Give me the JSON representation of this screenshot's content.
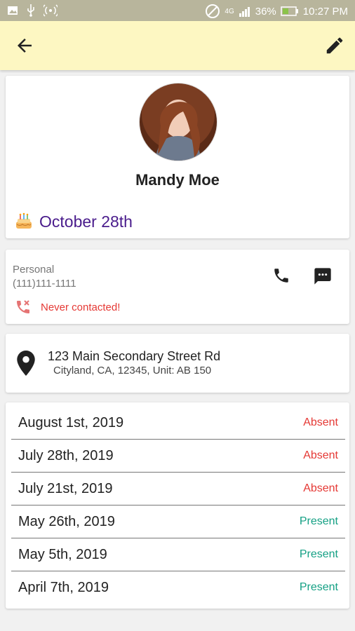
{
  "status_bar": {
    "battery": "36%",
    "time": "10:27 PM",
    "network": "4G"
  },
  "contact": {
    "name": "Mandy Moe",
    "birthday": "October 28th",
    "phone_type": "Personal",
    "phone_number": "(111)111-1111",
    "contact_status": "Never contacted!"
  },
  "address": {
    "line1": "123 Main Secondary Street Rd",
    "line2": "Cityland, CA, 12345, Unit: AB 150"
  },
  "attendance": [
    {
      "date": "August 1st, 2019",
      "status": "Absent"
    },
    {
      "date": "July 28th, 2019",
      "status": "Absent"
    },
    {
      "date": "July 21st, 2019",
      "status": "Absent"
    },
    {
      "date": "May 26th, 2019",
      "status": "Present"
    },
    {
      "date": "May 5th, 2019",
      "status": "Present"
    },
    {
      "date": "April 7th, 2019",
      "status": "Present"
    }
  ],
  "colors": {
    "appbar": "#fdf7c2",
    "accent_purple": "#4a1c8c",
    "absent": "#e53935",
    "present": "#14a084"
  },
  "icons": {
    "back": "arrow-back-icon",
    "edit": "pencil-icon",
    "birthday": "cake-icon",
    "phone": "phone-icon",
    "sms": "message-icon",
    "missed": "missed-call-icon",
    "location": "location-pin-icon"
  }
}
